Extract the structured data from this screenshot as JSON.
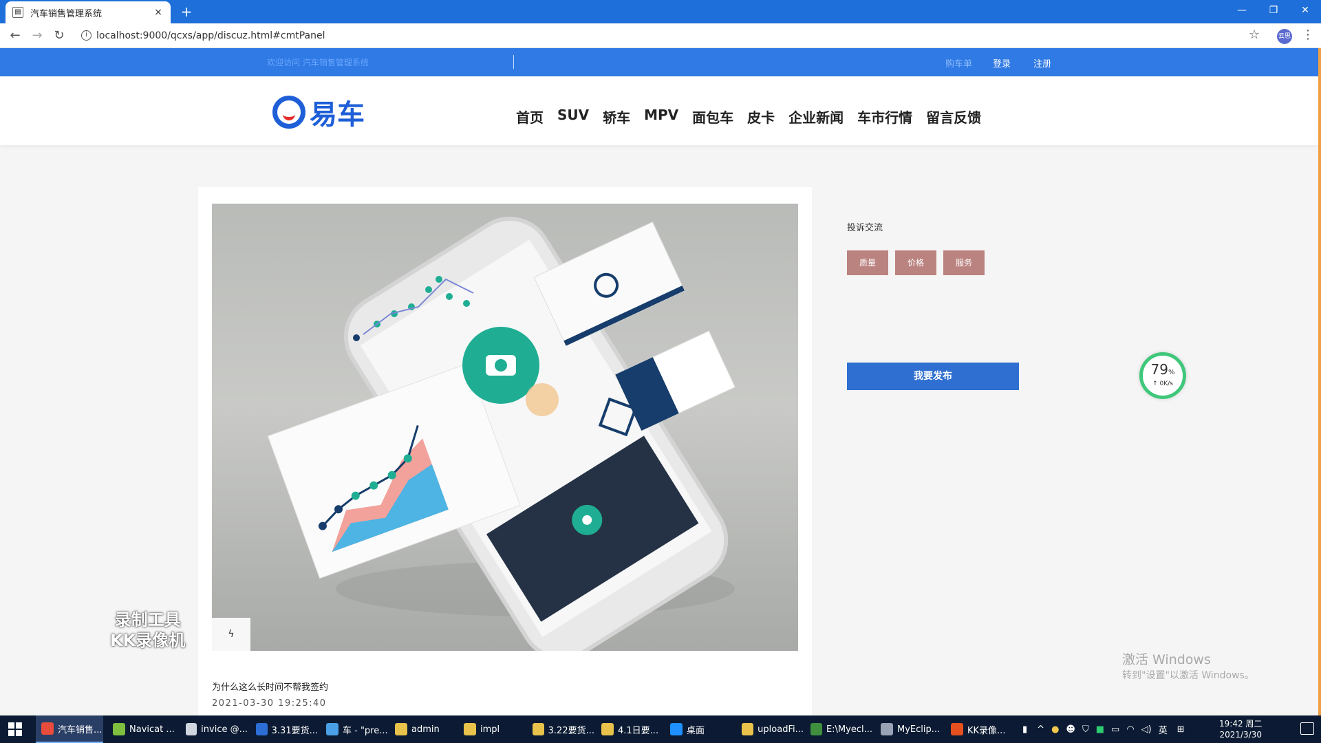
{
  "browser": {
    "tab_title": "汽车销售管理系统",
    "tab_close": "×",
    "new_tab": "+",
    "url": "localhost:9000/qcxs/app/discuz.html#cmtPanel",
    "profile_label": "云思"
  },
  "site": {
    "welcome": "欢迎访问 汽车销售管理系统",
    "top_links": [
      "购车单",
      "登录",
      "注册"
    ],
    "logo_text": "易车",
    "nav": [
      "首页",
      "SUV",
      "轿车",
      "MPV",
      "面包车",
      "皮卡",
      "企业新闻",
      "车市行情",
      "留言反馈"
    ]
  },
  "post": {
    "like_symbol": "ϟ",
    "title": "为什么这么长时间不帮我签约",
    "time": "2021-03-30 19:25:40"
  },
  "sidebar": {
    "title": "投诉交流",
    "tags": [
      "质量",
      "价格",
      "服务"
    ],
    "publish": "我要发布"
  },
  "speed_widget": {
    "percent": "79",
    "percent_unit": "%",
    "rate": "0K/s"
  },
  "overlay": {
    "watermark_line1": "录制工具",
    "watermark_line2": "KK录像机",
    "activate_title": "激活 Windows",
    "activate_sub": "转到\"设置\"以激活 Windows。"
  },
  "taskbar": {
    "items": [
      {
        "label": "汽车销售...",
        "color": "#e84c3d"
      },
      {
        "label": "Navicat ...",
        "color": "#7fbf3f"
      },
      {
        "label": "invice @...",
        "color": "#cfd6e0"
      },
      {
        "label": "3.31要货...",
        "color": "#2c6ed5"
      },
      {
        "label": "车 - \"pre...",
        "color": "#4aa0e6"
      },
      {
        "label": "admin",
        "color": "#e8c24a"
      },
      {
        "label": "impl",
        "color": "#e8c24a"
      },
      {
        "label": "3.22要货...",
        "color": "#e8c24a"
      },
      {
        "label": "4.1日要...",
        "color": "#e8c24a"
      },
      {
        "label": "桌面",
        "color": "#1e90ff"
      },
      {
        "label": "uploadFi...",
        "color": "#e8c24a"
      },
      {
        "label": "E:\\Myecl...",
        "color": "#3f8f3f"
      },
      {
        "label": "MyEclip...",
        "color": "#9aa3b5"
      },
      {
        "label": "KK录像...",
        "color": "#e5501e"
      }
    ],
    "ime": "英",
    "time": "19:42 周二",
    "date": "2021/3/30"
  }
}
